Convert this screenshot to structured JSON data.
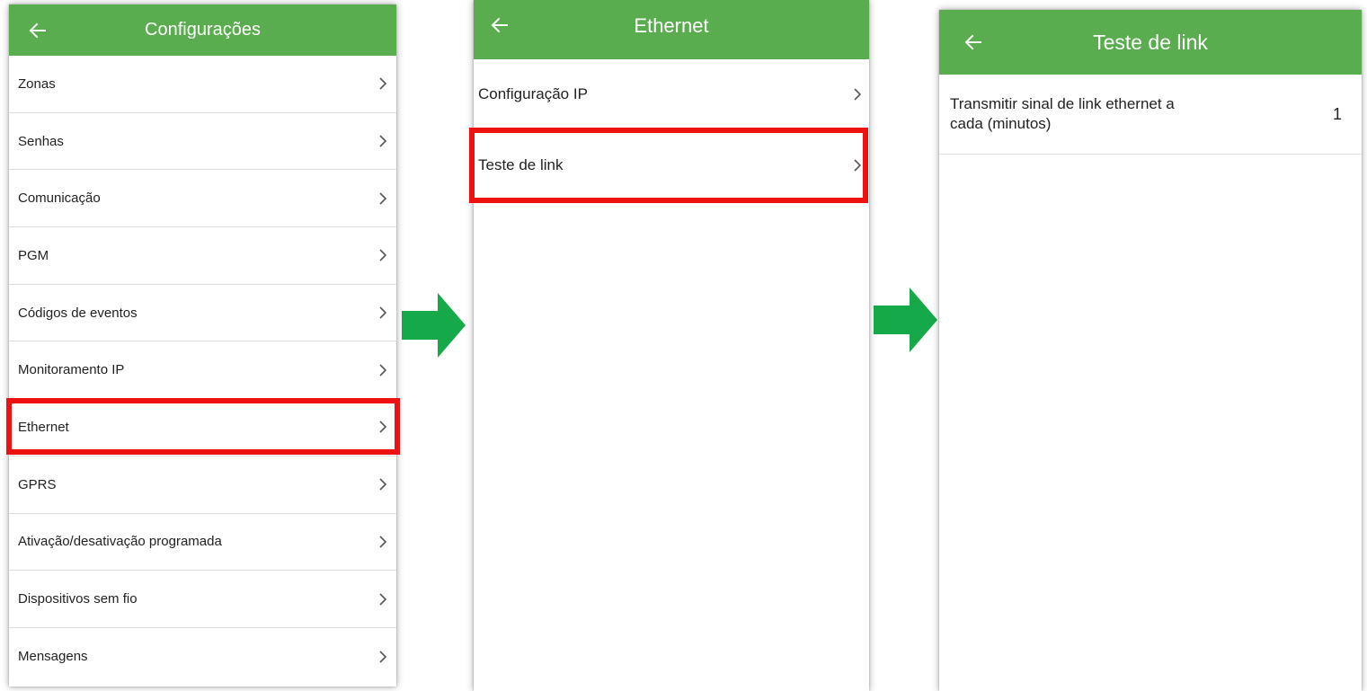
{
  "colors": {
    "appbar": "#5aad4e",
    "highlight": "#ee1111",
    "flow_arrow": "#16a94a",
    "divider": "#dcdcdc"
  },
  "icons": {
    "back": "arrow-left-icon",
    "row": "chevron-right-icon",
    "flow": "green-arrow-right-icon"
  },
  "screen1": {
    "title": "Configurações",
    "items": [
      {
        "label": "Zonas"
      },
      {
        "label": "Senhas"
      },
      {
        "label": "Comunicação"
      },
      {
        "label": "PGM"
      },
      {
        "label": "Códigos de eventos"
      },
      {
        "label": "Monitoramento IP"
      },
      {
        "label": "Ethernet"
      },
      {
        "label": "GPRS"
      },
      {
        "label": "Ativação/desativação programada"
      },
      {
        "label": "Dispositivos sem fio"
      },
      {
        "label": "Mensagens"
      }
    ]
  },
  "screen2": {
    "title": "Ethernet",
    "items": [
      {
        "label": "Configuração IP"
      },
      {
        "label": "Teste de link"
      }
    ]
  },
  "screen3": {
    "title": "Teste de link",
    "setting": {
      "label_line1": "Transmitir sinal de link ethernet a",
      "label_line2": "cada (minutos)",
      "value": "1"
    }
  }
}
